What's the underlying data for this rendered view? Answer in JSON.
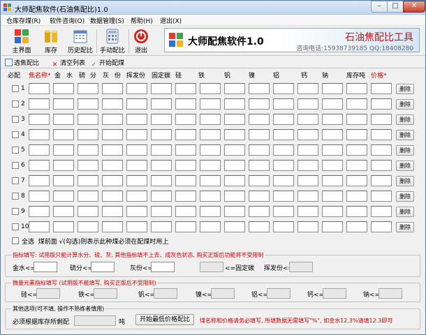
{
  "window": {
    "title": "大师配焦软件(石油焦配比)1.0",
    "controls": {
      "min": "–",
      "max": "□",
      "close": "✕"
    }
  },
  "menu": [
    "仓库存煤(R)",
    "软件咨询(O)",
    "数据管理(S)",
    "帮助(H)",
    "退出(X)"
  ],
  "toolbar": {
    "buttons": [
      {
        "label": "主界面",
        "icon": "grid-icon"
      },
      {
        "label": "库存",
        "icon": "cylinders-icon"
      },
      {
        "label": "历史配比",
        "icon": "calendar-icon"
      },
      {
        "label": "手动配比",
        "icon": "calculator-icon"
      },
      {
        "label": "退出",
        "icon": "power-icon"
      }
    ]
  },
  "banner": {
    "title": "大师配焦软件1.0",
    "subtitle": "石油焦配比工具",
    "contact": "咨询电话:15938739185  QQ:18408280"
  },
  "actions": {
    "select": "选焦配比",
    "clear": "清空列表",
    "start": "开始配煤"
  },
  "grid": {
    "headers": [
      {
        "text": "必配",
        "red": false
      },
      {
        "text": "焦名称*",
        "red": true
      },
      {
        "text": "金",
        "red": false
      },
      {
        "text": "水",
        "red": false
      },
      {
        "text": "硫",
        "red": false
      },
      {
        "text": "分",
        "red": false
      },
      {
        "text": "灰",
        "red": false
      },
      {
        "text": "份",
        "red": false
      },
      {
        "text": "挥发份",
        "red": false
      },
      {
        "text": "固定碳",
        "red": false
      },
      {
        "text": "硅",
        "red": false
      },
      {
        "text": "铁",
        "red": false
      },
      {
        "text": "钒",
        "red": false
      },
      {
        "text": "镍",
        "red": false
      },
      {
        "text": "铝",
        "red": false
      },
      {
        "text": "钙",
        "red": false
      },
      {
        "text": "钠",
        "red": false
      },
      {
        "text": "库存吨",
        "red": false
      },
      {
        "text": "价格*",
        "red": true
      }
    ],
    "rows": [
      "1",
      "2",
      "3",
      "4",
      "5",
      "6",
      "7",
      "8",
      "9",
      "10"
    ],
    "delete_label": "删除"
  },
  "select_all": {
    "label": "全选",
    "hint": "煤前面 √(勾选)则表示此种煤必须在配煤时用上"
  },
  "indicator_group": {
    "title": "指标填写: 试用版只能计算水分、硫、灰, 其他指标填不上去、成灰色状态, 购买正版后功能将不受限制",
    "fields": [
      {
        "label": "金水<="
      },
      {
        "label": "硫分<="
      },
      {
        "label": "灰份<="
      },
      {
        "label": "<=固定碳"
      },
      {
        "label": "挥发份<="
      }
    ]
  },
  "trace_group": {
    "title": "微量元素指标填写 (试用版不能填写, 购买正版后不受限制)",
    "fields": [
      "硅<=",
      "铁<=",
      "钒<=",
      "镍<=",
      "铝<=",
      "钙<=",
      "钠<="
    ]
  },
  "other_group": {
    "title": "其他选项(可不填, 操作不熟练者慎用)",
    "stock_label": "必须根据库存所剩配",
    "unit": "吨",
    "button": "开始最低价格配比",
    "note": "煤名称和价格请务必填写, 所填数据无需填写\"%\", 如金水12.3%请填12.3即可"
  }
}
